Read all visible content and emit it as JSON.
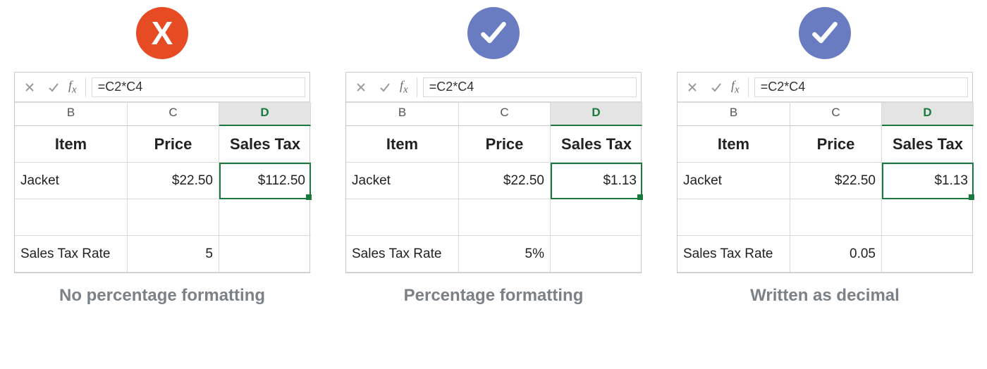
{
  "formula": "=C2*C4",
  "headers": {
    "b": "B",
    "c": "C",
    "d": "D",
    "item": "Item",
    "price": "Price",
    "tax": "Sales Tax"
  },
  "rowLabels": {
    "product": "Jacket",
    "rateLabel": "Sales Tax Rate"
  },
  "price": "$22.50",
  "panels": [
    {
      "badge": "cross",
      "taxValue": "$112.50",
      "rateValue": "5",
      "caption": "No percentage formatting"
    },
    {
      "badge": "check",
      "taxValue": "$1.13",
      "rateValue": "5%",
      "caption": "Percentage formatting"
    },
    {
      "badge": "check",
      "taxValue": "$1.13",
      "rateValue": "0.05",
      "caption": "Written as decimal"
    }
  ]
}
